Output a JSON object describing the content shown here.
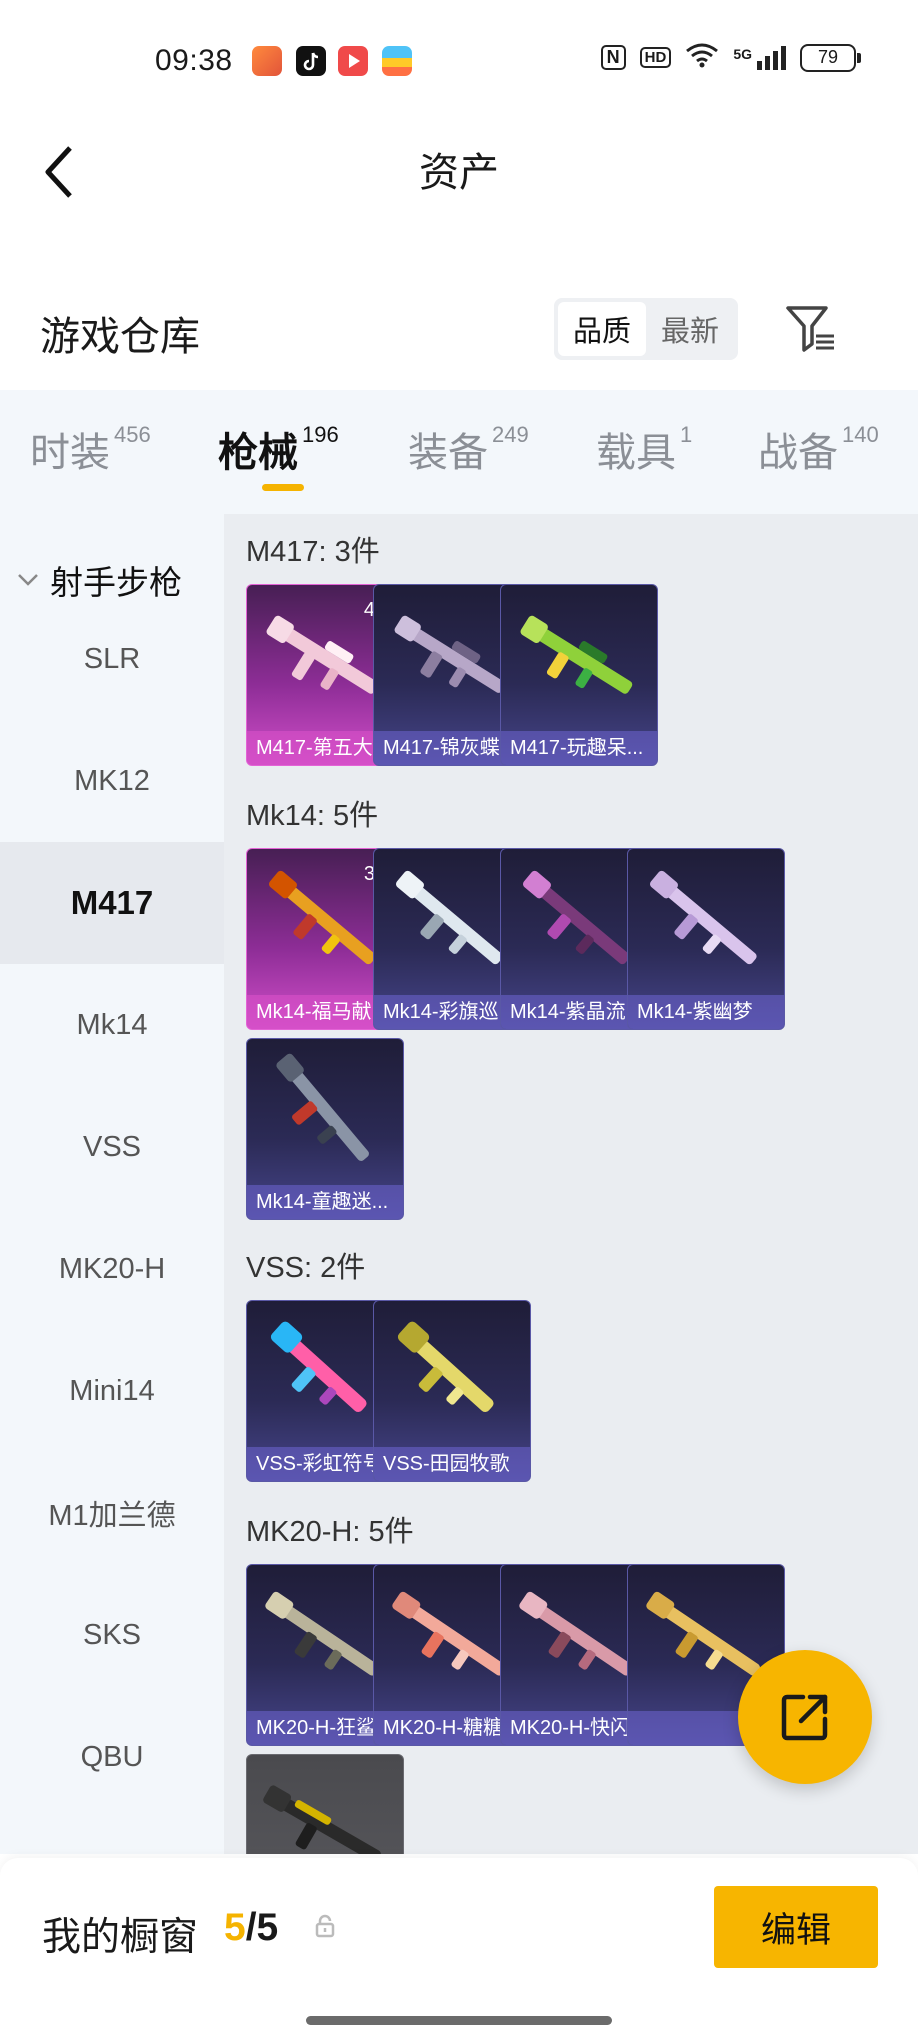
{
  "status_bar": {
    "time": "09:38",
    "battery": "79",
    "app_icons": [
      "game-app-icon",
      "tiktok-icon",
      "video-app-icon",
      "wallet-app-icon"
    ],
    "right_icons": [
      "nfc-icon",
      "hd-icon",
      "wifi-icon",
      "5g-signal-icon"
    ],
    "hd_label": "HD",
    "nfc_label": "N",
    "signal_label": "5G"
  },
  "header": {
    "title": "资产",
    "back_icon": "back-chevron-icon"
  },
  "warehouse": {
    "title": "游戏仓库",
    "sort_options": [
      "品质",
      "最新"
    ],
    "active_sort": "品质",
    "filter_icon": "filter-icon"
  },
  "tabs": [
    {
      "label": "时装",
      "count": "456"
    },
    {
      "label": "枪械",
      "count": "196"
    },
    {
      "label": "装备",
      "count": "249"
    },
    {
      "label": "载具",
      "count": "1"
    },
    {
      "label": "战备",
      "count": "140"
    }
  ],
  "active_tab": "枪械",
  "sidebar": {
    "header": "射手步枪",
    "items": [
      "SLR",
      "MK12",
      "M417",
      "Mk14",
      "VSS",
      "MK20-H",
      "Mini14",
      "M1加兰德",
      "SKS",
      "QBU"
    ],
    "active": "M417"
  },
  "groups": [
    {
      "label": "M417: 3件",
      "items": [
        {
          "name": "M417-第五大...",
          "level": "4级",
          "rarity": "legendary"
        },
        {
          "name": "M417-锦灰蝶...",
          "level": "",
          "rarity": "epic"
        },
        {
          "name": "M417-玩趣呆...",
          "level": "",
          "rarity": "epic"
        }
      ]
    },
    {
      "label": "Mk14: 5件",
      "items": [
        {
          "name": "Mk14-福马献...",
          "level": "3级",
          "rarity": "legendary"
        },
        {
          "name": "Mk14-彩旗巡...",
          "level": "",
          "rarity": "epic"
        },
        {
          "name": "Mk14-紫晶流...",
          "level": "",
          "rarity": "epic"
        },
        {
          "name": "Mk14-紫幽梦",
          "level": "",
          "rarity": "epic"
        },
        {
          "name": "Mk14-童趣迷...",
          "level": "",
          "rarity": "epic"
        }
      ]
    },
    {
      "label": "VSS: 2件",
      "items": [
        {
          "name": "VSS-彩虹符号",
          "level": "",
          "rarity": "epic"
        },
        {
          "name": "VSS-田园牧歌",
          "level": "",
          "rarity": "epic"
        }
      ]
    },
    {
      "label": "MK20-H: 5件",
      "items": [
        {
          "name": "MK20-H-狂鲨...",
          "level": "",
          "rarity": "epic"
        },
        {
          "name": "MK20-H-糖糖...",
          "level": "",
          "rarity": "epic"
        },
        {
          "name": "MK20-H-快闪...",
          "level": "",
          "rarity": "epic"
        },
        {
          "name": "",
          "level": "",
          "rarity": "epic"
        },
        {
          "name": "",
          "level": "",
          "rarity": "common"
        }
      ]
    }
  ],
  "fab_icon": "share-external-icon",
  "showcase": {
    "label": "我的橱窗",
    "current": "5",
    "separator": "/",
    "total": "5",
    "lock_icon": "lock-icon",
    "edit_label": "编辑"
  },
  "colors": {
    "accent": "#f7b500",
    "legendary": "#d14ec9",
    "epic": "#46458a"
  }
}
